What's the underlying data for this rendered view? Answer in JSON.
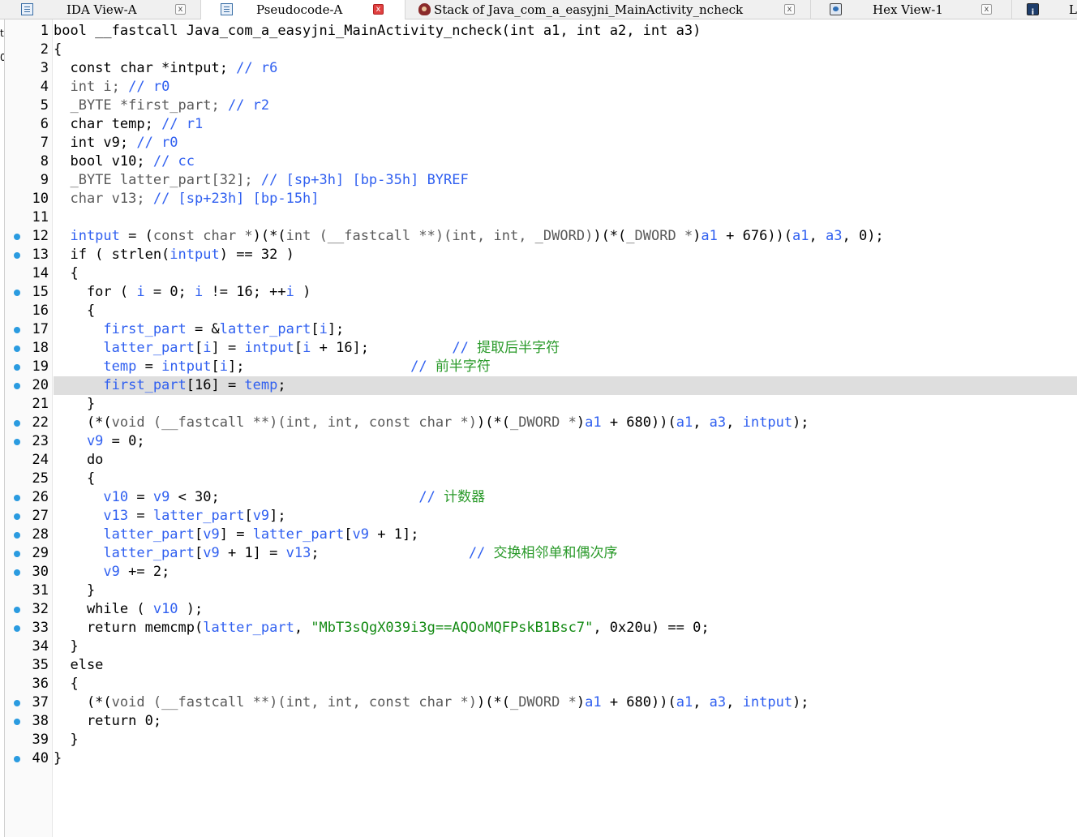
{
  "tabs": [
    {
      "label": "IDA View-A",
      "icon": "document-icon",
      "close": "x"
    },
    {
      "label": "Pseudocode-A",
      "icon": "document-icon",
      "close": "x"
    },
    {
      "label": "Stack of Java_com_a_easyjni_MainActivity_ncheck",
      "icon": "stack-icon",
      "close": "x"
    },
    {
      "label": "Hex View-1",
      "icon": "hex-view-icon",
      "close": "x"
    },
    {
      "label": "L",
      "icon": "info-icon",
      "close": ""
    }
  ],
  "colors": {
    "keyword": "#000000",
    "type": "#5a5a5a",
    "variable": "#2f5ff0",
    "comment": "#2f5ff0",
    "chinese_comment": "#2a9a2a",
    "string": "#138a13",
    "breakpoint_dot": "#2a9be0",
    "highlight": "#dedede"
  },
  "highlighted_line": 20,
  "left_edge_chars": [
    "t",
    "0"
  ],
  "lines": [
    {
      "n": "1",
      "dot": false,
      "parts": [
        [
          "pl",
          "bool __fastcall Java_com_a_easyjni_MainActivity_ncheck(int a1, int a2, int a3)"
        ]
      ]
    },
    {
      "n": "2",
      "dot": false,
      "parts": [
        [
          "pl",
          "{"
        ]
      ]
    },
    {
      "n": "3",
      "dot": false,
      "parts": [
        [
          "pl",
          "  const char *intput; "
        ],
        [
          "cm",
          "// r6"
        ]
      ]
    },
    {
      "n": "4",
      "dot": false,
      "parts": [
        [
          "ty",
          "  int i; "
        ],
        [
          "cm",
          "// r0"
        ]
      ]
    },
    {
      "n": "5",
      "dot": false,
      "parts": [
        [
          "ty",
          "  _BYTE *first_part; "
        ],
        [
          "cm",
          "// r2"
        ]
      ]
    },
    {
      "n": "6",
      "dot": false,
      "parts": [
        [
          "pl",
          "  char temp; "
        ],
        [
          "cm",
          "// r1"
        ]
      ]
    },
    {
      "n": "7",
      "dot": false,
      "parts": [
        [
          "pl",
          "  int v9; "
        ],
        [
          "cm",
          "// r0"
        ]
      ]
    },
    {
      "n": "8",
      "dot": false,
      "parts": [
        [
          "pl",
          "  bool v10; "
        ],
        [
          "cm",
          "// cc"
        ]
      ]
    },
    {
      "n": "9",
      "dot": false,
      "parts": [
        [
          "ty",
          "  _BYTE latter_part[32]; "
        ],
        [
          "cm",
          "// [sp+3h] [bp-35h] BYREF"
        ]
      ]
    },
    {
      "n": "10",
      "dot": false,
      "parts": [
        [
          "ty",
          "  char v13; "
        ],
        [
          "cm",
          "// [sp+23h] [bp-15h]"
        ]
      ]
    },
    {
      "n": "11",
      "dot": false,
      "parts": [
        [
          "pl",
          ""
        ]
      ]
    },
    {
      "n": "12",
      "dot": true,
      "parts": [
        [
          "var",
          "  intput"
        ],
        [
          "pl",
          " = ("
        ],
        [
          "ty",
          "const char *"
        ],
        [
          "pl",
          ")(*("
        ],
        [
          "ty",
          "int (__fastcall **)(int, int, _DWORD)"
        ],
        [
          "pl",
          ")(*("
        ],
        [
          "ty",
          "_DWORD *"
        ],
        [
          "pl",
          ")"
        ],
        [
          "var",
          "a1"
        ],
        [
          "pl",
          " + 676))("
        ],
        [
          "var",
          "a1"
        ],
        [
          "pl",
          ", "
        ],
        [
          "var",
          "a3"
        ],
        [
          "pl",
          ", 0);"
        ]
      ]
    },
    {
      "n": "13",
      "dot": true,
      "parts": [
        [
          "pl",
          "  if ( strlen("
        ],
        [
          "var",
          "intput"
        ],
        [
          "pl",
          ") == 32 )"
        ]
      ]
    },
    {
      "n": "14",
      "dot": false,
      "parts": [
        [
          "pl",
          "  {"
        ]
      ]
    },
    {
      "n": "15",
      "dot": true,
      "parts": [
        [
          "pl",
          "    for ( "
        ],
        [
          "var",
          "i"
        ],
        [
          "pl",
          " = 0; "
        ],
        [
          "var",
          "i"
        ],
        [
          "pl",
          " != 16; ++"
        ],
        [
          "var",
          "i"
        ],
        [
          "pl",
          " )"
        ]
      ]
    },
    {
      "n": "16",
      "dot": false,
      "parts": [
        [
          "pl",
          "    {"
        ]
      ]
    },
    {
      "n": "17",
      "dot": true,
      "parts": [
        [
          "var",
          "      first_part"
        ],
        [
          "pl",
          " = &"
        ],
        [
          "var",
          "latter_part"
        ],
        [
          "pl",
          "["
        ],
        [
          "var",
          "i"
        ],
        [
          "pl",
          "];"
        ]
      ]
    },
    {
      "n": "18",
      "dot": true,
      "parts": [
        [
          "var",
          "      latter_part"
        ],
        [
          "pl",
          "["
        ],
        [
          "var",
          "i"
        ],
        [
          "pl",
          "] = "
        ],
        [
          "var",
          "intput"
        ],
        [
          "pl",
          "["
        ],
        [
          "var",
          "i"
        ],
        [
          "pl",
          " + 16];          "
        ],
        [
          "cm",
          "// "
        ],
        [
          "zh",
          "提取后半字符"
        ]
      ]
    },
    {
      "n": "19",
      "dot": true,
      "parts": [
        [
          "var",
          "      temp"
        ],
        [
          "pl",
          " = "
        ],
        [
          "var",
          "intput"
        ],
        [
          "pl",
          "["
        ],
        [
          "var",
          "i"
        ],
        [
          "pl",
          "];                    "
        ],
        [
          "cm",
          "// "
        ],
        [
          "zh",
          "前半字符"
        ]
      ]
    },
    {
      "n": "20",
      "dot": true,
      "parts": [
        [
          "var",
          "      first_part"
        ],
        [
          "pl",
          "[16] = "
        ],
        [
          "var",
          "temp"
        ],
        [
          "pl",
          ";"
        ]
      ]
    },
    {
      "n": "21",
      "dot": false,
      "parts": [
        [
          "pl",
          "    }"
        ]
      ]
    },
    {
      "n": "22",
      "dot": true,
      "parts": [
        [
          "pl",
          "    (*("
        ],
        [
          "ty",
          "void (__fastcall **)(int, int, const char *)"
        ],
        [
          "pl",
          ")(*("
        ],
        [
          "ty",
          "_DWORD *"
        ],
        [
          "pl",
          ")"
        ],
        [
          "var",
          "a1"
        ],
        [
          "pl",
          " + 680))("
        ],
        [
          "var",
          "a1"
        ],
        [
          "pl",
          ", "
        ],
        [
          "var",
          "a3"
        ],
        [
          "pl",
          ", "
        ],
        [
          "var",
          "intput"
        ],
        [
          "pl",
          ");"
        ]
      ]
    },
    {
      "n": "23",
      "dot": true,
      "parts": [
        [
          "var",
          "    v9"
        ],
        [
          "pl",
          " = 0;"
        ]
      ]
    },
    {
      "n": "24",
      "dot": false,
      "parts": [
        [
          "pl",
          "    do"
        ]
      ]
    },
    {
      "n": "25",
      "dot": false,
      "parts": [
        [
          "pl",
          "    {"
        ]
      ]
    },
    {
      "n": "26",
      "dot": true,
      "parts": [
        [
          "var",
          "      v10"
        ],
        [
          "pl",
          " = "
        ],
        [
          "var",
          "v9"
        ],
        [
          "pl",
          " < 30;                        "
        ],
        [
          "cm",
          "// "
        ],
        [
          "zh",
          "计数器"
        ]
      ]
    },
    {
      "n": "27",
      "dot": true,
      "parts": [
        [
          "var",
          "      v13"
        ],
        [
          "pl",
          " = "
        ],
        [
          "var",
          "latter_part"
        ],
        [
          "pl",
          "["
        ],
        [
          "var",
          "v9"
        ],
        [
          "pl",
          "];"
        ]
      ]
    },
    {
      "n": "28",
      "dot": true,
      "parts": [
        [
          "var",
          "      latter_part"
        ],
        [
          "pl",
          "["
        ],
        [
          "var",
          "v9"
        ],
        [
          "pl",
          "] = "
        ],
        [
          "var",
          "latter_part"
        ],
        [
          "pl",
          "["
        ],
        [
          "var",
          "v9"
        ],
        [
          "pl",
          " + 1];"
        ]
      ]
    },
    {
      "n": "29",
      "dot": true,
      "parts": [
        [
          "var",
          "      latter_part"
        ],
        [
          "pl",
          "["
        ],
        [
          "var",
          "v9"
        ],
        [
          "pl",
          " + 1] = "
        ],
        [
          "var",
          "v13"
        ],
        [
          "pl",
          ";                  "
        ],
        [
          "cm",
          "// "
        ],
        [
          "zh",
          "交换相邻单和偶次序"
        ]
      ]
    },
    {
      "n": "30",
      "dot": true,
      "parts": [
        [
          "var",
          "      v9"
        ],
        [
          "pl",
          " += 2;"
        ]
      ]
    },
    {
      "n": "31",
      "dot": false,
      "parts": [
        [
          "pl",
          "    }"
        ]
      ]
    },
    {
      "n": "32",
      "dot": true,
      "parts": [
        [
          "pl",
          "    while ( "
        ],
        [
          "var",
          "v10"
        ],
        [
          "pl",
          " );"
        ]
      ]
    },
    {
      "n": "33",
      "dot": true,
      "parts": [
        [
          "pl",
          "    return memcmp("
        ],
        [
          "var",
          "latter_part"
        ],
        [
          "pl",
          ", "
        ],
        [
          "str",
          "\"MbT3sQgX039i3g==AQOoMQFPskB1Bsc7\""
        ],
        [
          "pl",
          ", 0x20u) == 0;"
        ]
      ]
    },
    {
      "n": "34",
      "dot": false,
      "parts": [
        [
          "pl",
          "  }"
        ]
      ]
    },
    {
      "n": "35",
      "dot": false,
      "parts": [
        [
          "pl",
          "  else"
        ]
      ]
    },
    {
      "n": "36",
      "dot": false,
      "parts": [
        [
          "pl",
          "  {"
        ]
      ]
    },
    {
      "n": "37",
      "dot": true,
      "parts": [
        [
          "pl",
          "    (*("
        ],
        [
          "ty",
          "void (__fastcall **)(int, int, const char *)"
        ],
        [
          "pl",
          ")(*("
        ],
        [
          "ty",
          "_DWORD *"
        ],
        [
          "pl",
          ")"
        ],
        [
          "var",
          "a1"
        ],
        [
          "pl",
          " + 680))("
        ],
        [
          "var",
          "a1"
        ],
        [
          "pl",
          ", "
        ],
        [
          "var",
          "a3"
        ],
        [
          "pl",
          ", "
        ],
        [
          "var",
          "intput"
        ],
        [
          "pl",
          ");"
        ]
      ]
    },
    {
      "n": "38",
      "dot": true,
      "parts": [
        [
          "pl",
          "    return 0;"
        ]
      ]
    },
    {
      "n": "39",
      "dot": false,
      "parts": [
        [
          "pl",
          "  }"
        ]
      ]
    },
    {
      "n": "40",
      "dot": true,
      "parts": [
        [
          "pl",
          "}"
        ]
      ]
    }
  ]
}
